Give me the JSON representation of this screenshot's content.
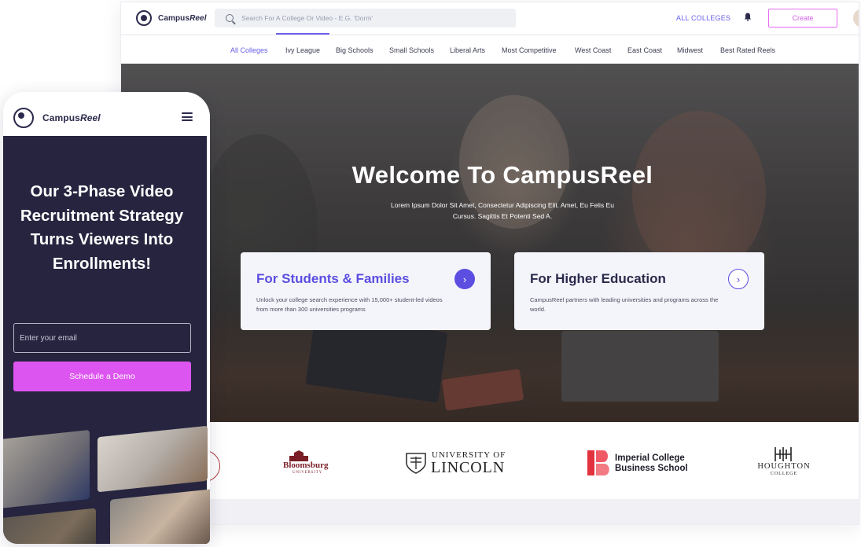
{
  "desktop": {
    "brand": {
      "name_regular": "Campus",
      "name_italic": "Reel"
    },
    "search": {
      "placeholder": "Search For A College Or Video - E.G. 'Dorm'"
    },
    "all_colleges_label": "ALL COLLEGES",
    "create_label": "Create",
    "nav_tabs": [
      {
        "label": "All Colleges",
        "active": true
      },
      {
        "label": "Ivy League"
      },
      {
        "label": "Big Schools"
      },
      {
        "label": "Small Schools"
      },
      {
        "label": "Liberal Arts"
      },
      {
        "label": "Most Competitive"
      },
      {
        "label": "West Coast"
      },
      {
        "label": "East Coast"
      },
      {
        "label": "Midwest"
      },
      {
        "label": "Best Rated Reels"
      }
    ],
    "hero": {
      "title": "Welcome To CampusReel",
      "subtitle": "Lorem Ipsum Dolor Sit Amet, Consectetur Adipiscing Elit. Amet, Eu Felis Eu Cursus. Sagittis Et Potenti Sed A."
    },
    "cards": [
      {
        "title": "For Students & Families",
        "description": "Unlock your college search experience with 15,000+ student-led videos from more than 300 universities programs",
        "title_color": "#5b4ee0"
      },
      {
        "title": "For Higher Education",
        "description": "CampusReel partners with leading universities and programs across the world.",
        "title_color": "#2b2a4c"
      }
    ],
    "logos": [
      {
        "line1": "Bloomsburg",
        "line2": "UNIVERSITY"
      },
      {
        "line1": "UNIVERSITY OF",
        "line2": "LINCOLN"
      },
      {
        "line1": "Imperial College",
        "line2": "Business School"
      },
      {
        "line1": "HOUGHTON",
        "line2": "COLLEGE"
      }
    ]
  },
  "mobile": {
    "brand": {
      "name_regular": "Campus",
      "name_italic": "Reel"
    },
    "headline": "Our 3-Phase Video Recruitment Strategy Turns Viewers Into Enrollments!",
    "email_placeholder": "Enter your email",
    "cta_label": "Schedule a Demo"
  },
  "colors": {
    "accent": "#6a60e8",
    "cta": "#dd55f0",
    "dark": "#26243f"
  }
}
